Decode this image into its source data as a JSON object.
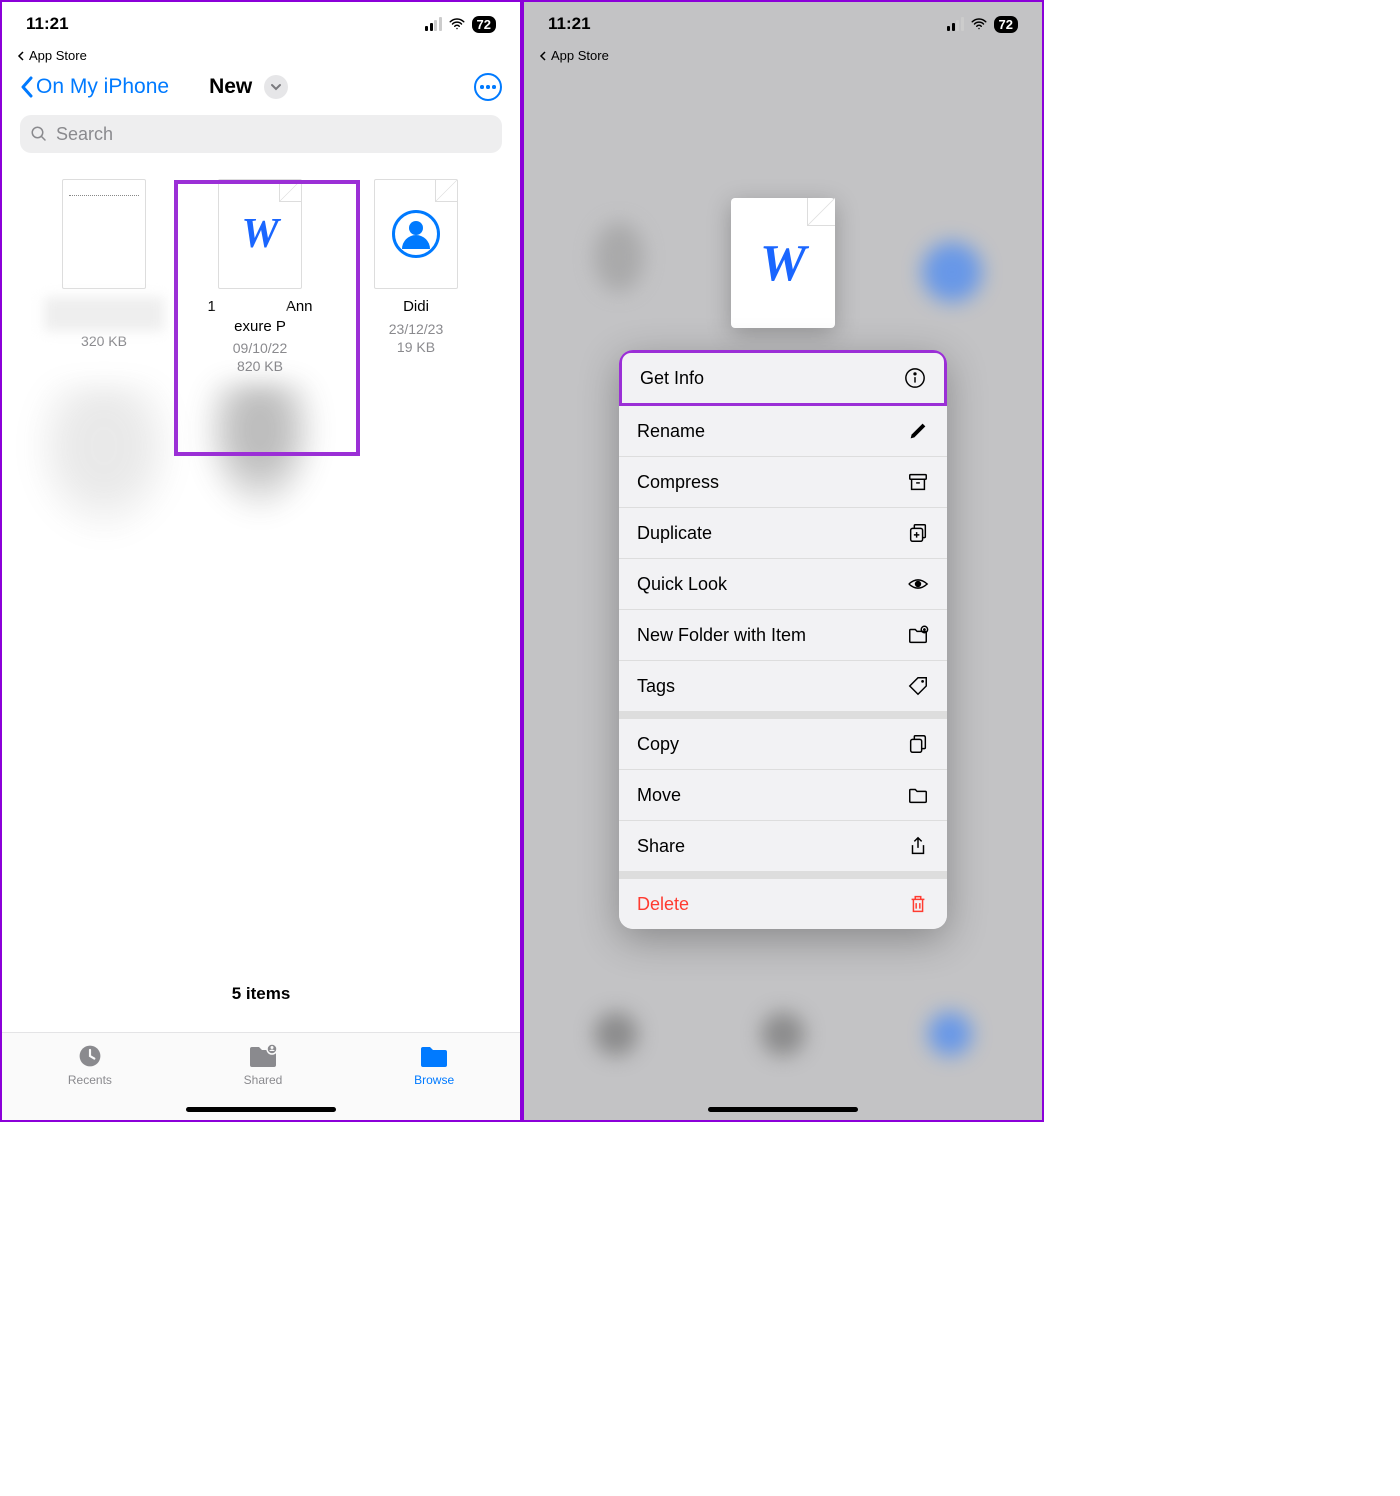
{
  "status": {
    "time": "11:21",
    "battery": "72",
    "back_app": "App Store"
  },
  "nav": {
    "back_label": "On My iPhone",
    "title": "New"
  },
  "search": {
    "placeholder": "Search"
  },
  "files": [
    {
      "name_line1": "",
      "name_line2": "",
      "date": "",
      "size": "320 KB"
    },
    {
      "name_prefix": "1",
      "name_mid": "Ann",
      "name_line2": "exure P",
      "date": "09/10/22",
      "size": "820 KB"
    },
    {
      "name_line1": "Didi",
      "date": "23/12/23",
      "size": "19 KB"
    }
  ],
  "footer": {
    "count": "5 items"
  },
  "tabs": {
    "recents": "Recents",
    "shared": "Shared",
    "browse": "Browse"
  },
  "menu": {
    "get_info": "Get Info",
    "rename": "Rename",
    "compress": "Compress",
    "duplicate": "Duplicate",
    "quick_look": "Quick Look",
    "new_folder": "New Folder with Item",
    "tags": "Tags",
    "copy": "Copy",
    "move": "Move",
    "share": "Share",
    "delete": "Delete"
  }
}
